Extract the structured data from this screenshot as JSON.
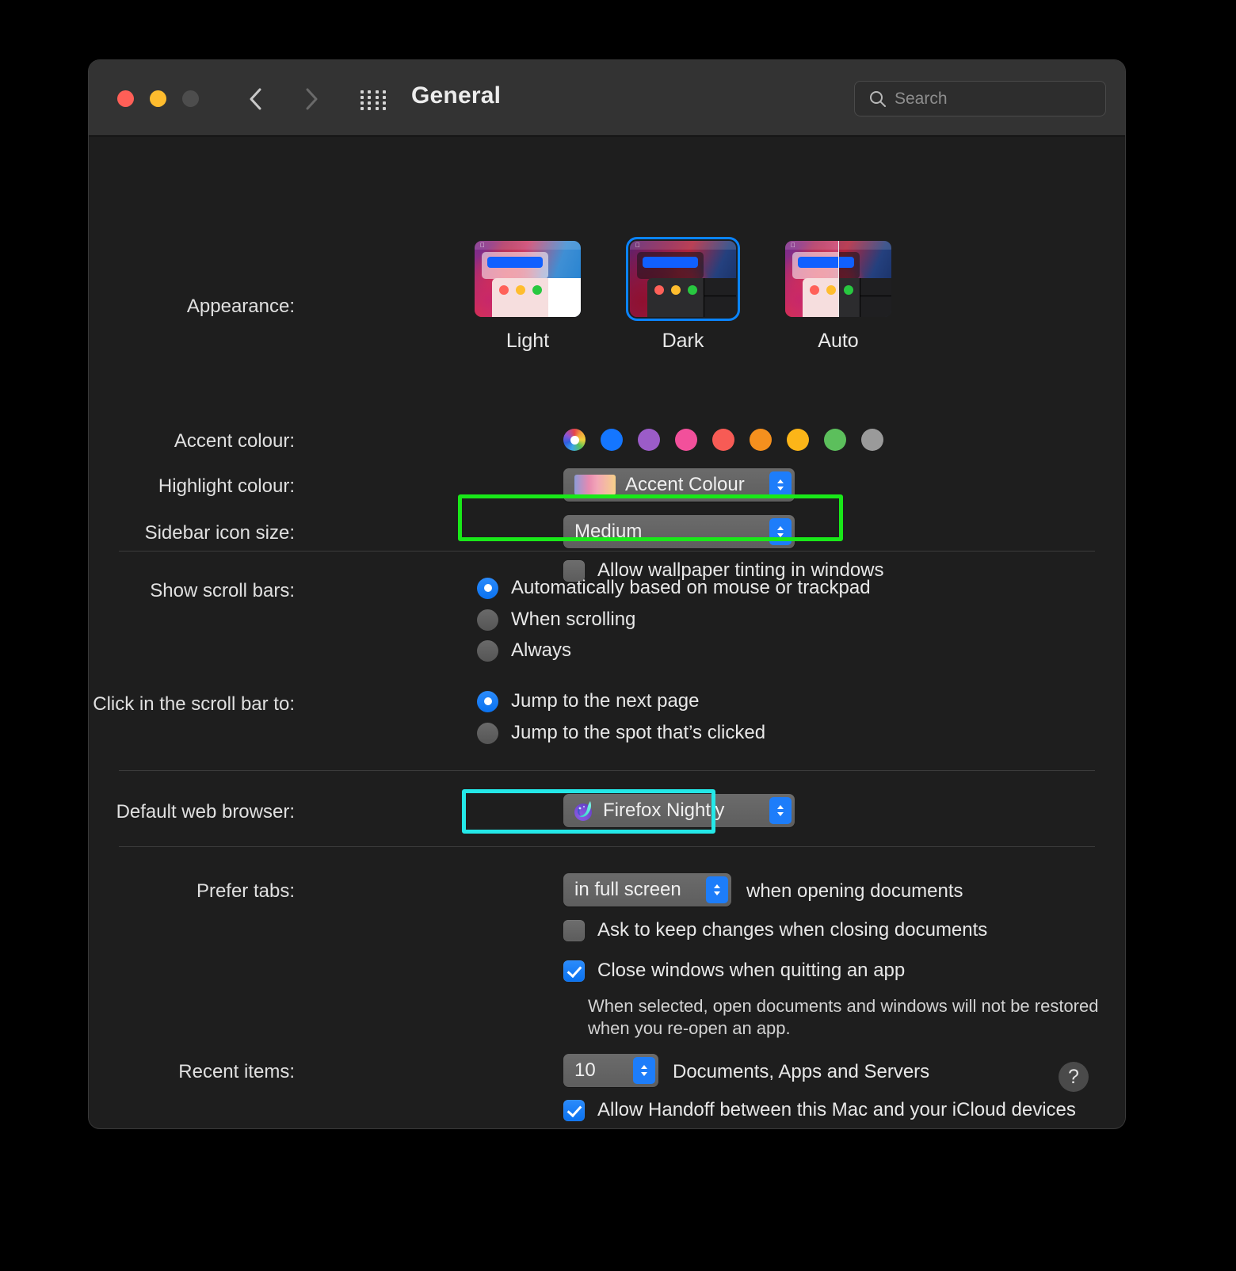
{
  "window": {
    "title": "General",
    "traffic_lights": [
      "close",
      "minimize",
      "zoom"
    ],
    "search": {
      "placeholder": "Search",
      "value": ""
    },
    "help_label": "?"
  },
  "appearance": {
    "label": "Appearance:",
    "options": [
      {
        "name": "Light",
        "selected": false
      },
      {
        "name": "Dark",
        "selected": true
      },
      {
        "name": "Auto",
        "selected": false
      }
    ]
  },
  "accent_colour": {
    "label": "Accent colour:",
    "swatches": [
      {
        "name": "multicolour",
        "color": "multi"
      },
      {
        "name": "blue",
        "color": "#1476ff"
      },
      {
        "name": "purple",
        "color": "#9b5cc8"
      },
      {
        "name": "pink",
        "color": "#f2509b"
      },
      {
        "name": "red",
        "color": "#f75b55"
      },
      {
        "name": "orange",
        "color": "#f5901e"
      },
      {
        "name": "yellow",
        "color": "#fcb518"
      },
      {
        "name": "green",
        "color": "#5cbf5c"
      },
      {
        "name": "graphite",
        "color": "#9a9a9a"
      }
    ]
  },
  "highlight_colour": {
    "label": "Highlight colour:",
    "value": "Accent Colour"
  },
  "sidebar_icon_size": {
    "label": "Sidebar icon size:",
    "value": "Medium"
  },
  "wallpaper_tinting": {
    "label": "Allow wallpaper tinting in windows",
    "checked": false,
    "highlight": "#19e819"
  },
  "show_scroll_bars": {
    "label": "Show scroll bars:",
    "options": [
      {
        "label": "Automatically based on mouse or trackpad",
        "selected": true
      },
      {
        "label": "When scrolling",
        "selected": false
      },
      {
        "label": "Always",
        "selected": false
      }
    ]
  },
  "click_scroll_bar": {
    "label": "Click in the scroll bar to:",
    "options": [
      {
        "label": "Jump to the next page",
        "selected": true
      },
      {
        "label": "Jump to the spot that’s clicked",
        "selected": false
      }
    ]
  },
  "default_web_browser": {
    "label": "Default web browser:",
    "value": "Firefox Nightly",
    "icon": "firefox-nightly-icon",
    "highlight": "#24e8e8"
  },
  "prefer_tabs": {
    "label": "Prefer tabs:",
    "value": "in full screen",
    "suffix": "when opening documents"
  },
  "ask_keep_changes": {
    "label": "Ask to keep changes when closing documents",
    "checked": false
  },
  "close_windows_quitting": {
    "label": "Close windows when quitting an app",
    "checked": true,
    "note_line1": "When selected, open documents and windows will not be restored",
    "note_line2": "when you re-open an app."
  },
  "recent_items": {
    "label": "Recent items:",
    "value": "10",
    "suffix": "Documents, Apps and Servers"
  },
  "handoff": {
    "label": "Allow Handoff between this Mac and your iCloud devices",
    "checked": true
  }
}
